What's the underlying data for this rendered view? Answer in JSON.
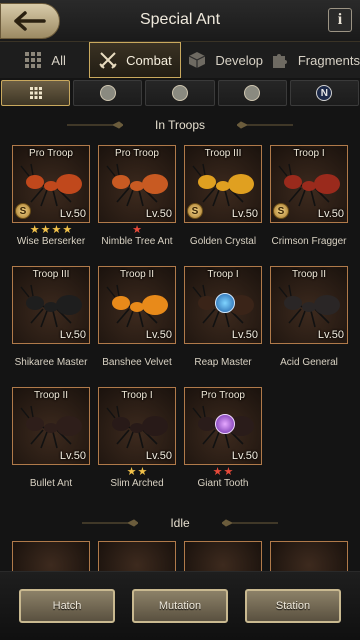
{
  "header": {
    "title": "Special Ant",
    "back_icon": "back-arrow-icon",
    "info_label": "i"
  },
  "tabs": [
    {
      "label": "All",
      "icon": "grid-icon",
      "active": false
    },
    {
      "label": "Combat",
      "icon": "crossed-swords-icon",
      "active": true
    },
    {
      "label": "Develop",
      "icon": "cube-icon",
      "active": false
    },
    {
      "label": "Fragments",
      "icon": "puzzle-icon",
      "active": false
    }
  ],
  "filters": [
    {
      "icon": "grid-icon",
      "active": true
    },
    {
      "icon": "infantry-icon",
      "active": false
    },
    {
      "icon": "shooter-icon",
      "active": false
    },
    {
      "icon": "carrier-icon",
      "active": false
    },
    {
      "icon": "neutral-icon",
      "label": "N",
      "active": false
    }
  ],
  "sections": {
    "in_troops": "In Troops",
    "idle": "Idle"
  },
  "ants": [
    {
      "troop": "Pro Troop",
      "level": "Lv.50",
      "name": "Wise Berserker",
      "stars": 4,
      "star_color": "gold",
      "badge": "S",
      "color": "#c0481c"
    },
    {
      "troop": "Pro Troop",
      "level": "Lv.50",
      "name": "Nimble Tree Ant",
      "stars": 1,
      "star_color": "red",
      "badge": "",
      "color": "#c85a22"
    },
    {
      "troop": "Troop III",
      "level": "Lv.50",
      "name": "Golden Crystal",
      "stars": 0,
      "star_color": "gold",
      "badge": "S",
      "color": "#e0a020"
    },
    {
      "troop": "Troop I",
      "level": "Lv.50",
      "name": "Crimson Fragger",
      "stars": 0,
      "star_color": "gold",
      "badge": "S",
      "color": "#9a2a1c"
    },
    {
      "troop": "Troop III",
      "level": "Lv.50",
      "name": "Shikaree Master",
      "stars": 0,
      "star_color": "gold",
      "badge": "",
      "color": "#1e1e1e"
    },
    {
      "troop": "Troop II",
      "level": "Lv.50",
      "name": "Banshee Velvet",
      "stars": 0,
      "star_color": "gold",
      "badge": "",
      "color": "#e88a1a"
    },
    {
      "troop": "Troop I",
      "level": "Lv.50",
      "name": "Reap Master",
      "stars": 0,
      "star_color": "gold",
      "badge": "",
      "color": "#3a2418"
    },
    {
      "troop": "Troop II",
      "level": "Lv.50",
      "name": "Acid General",
      "stars": 0,
      "star_color": "gold",
      "badge": "",
      "color": "#2a2626"
    },
    {
      "troop": "Troop II",
      "level": "Lv.50",
      "name": "Bullet Ant",
      "stars": 0,
      "star_color": "gold",
      "badge": "",
      "color": "#2e1e1a"
    },
    {
      "troop": "Troop I",
      "level": "Lv.50",
      "name": "Slim Arched",
      "stars": 2,
      "star_color": "gold",
      "badge": "",
      "color": "#281a18"
    },
    {
      "troop": "Pro Troop",
      "level": "Lv.50",
      "name": "Giant Tooth",
      "stars": 2,
      "star_color": "red",
      "badge": "",
      "color": "#2a1c1a"
    }
  ],
  "actions": {
    "hatch": "Hatch",
    "mutation": "Mutation",
    "station": "Station"
  }
}
